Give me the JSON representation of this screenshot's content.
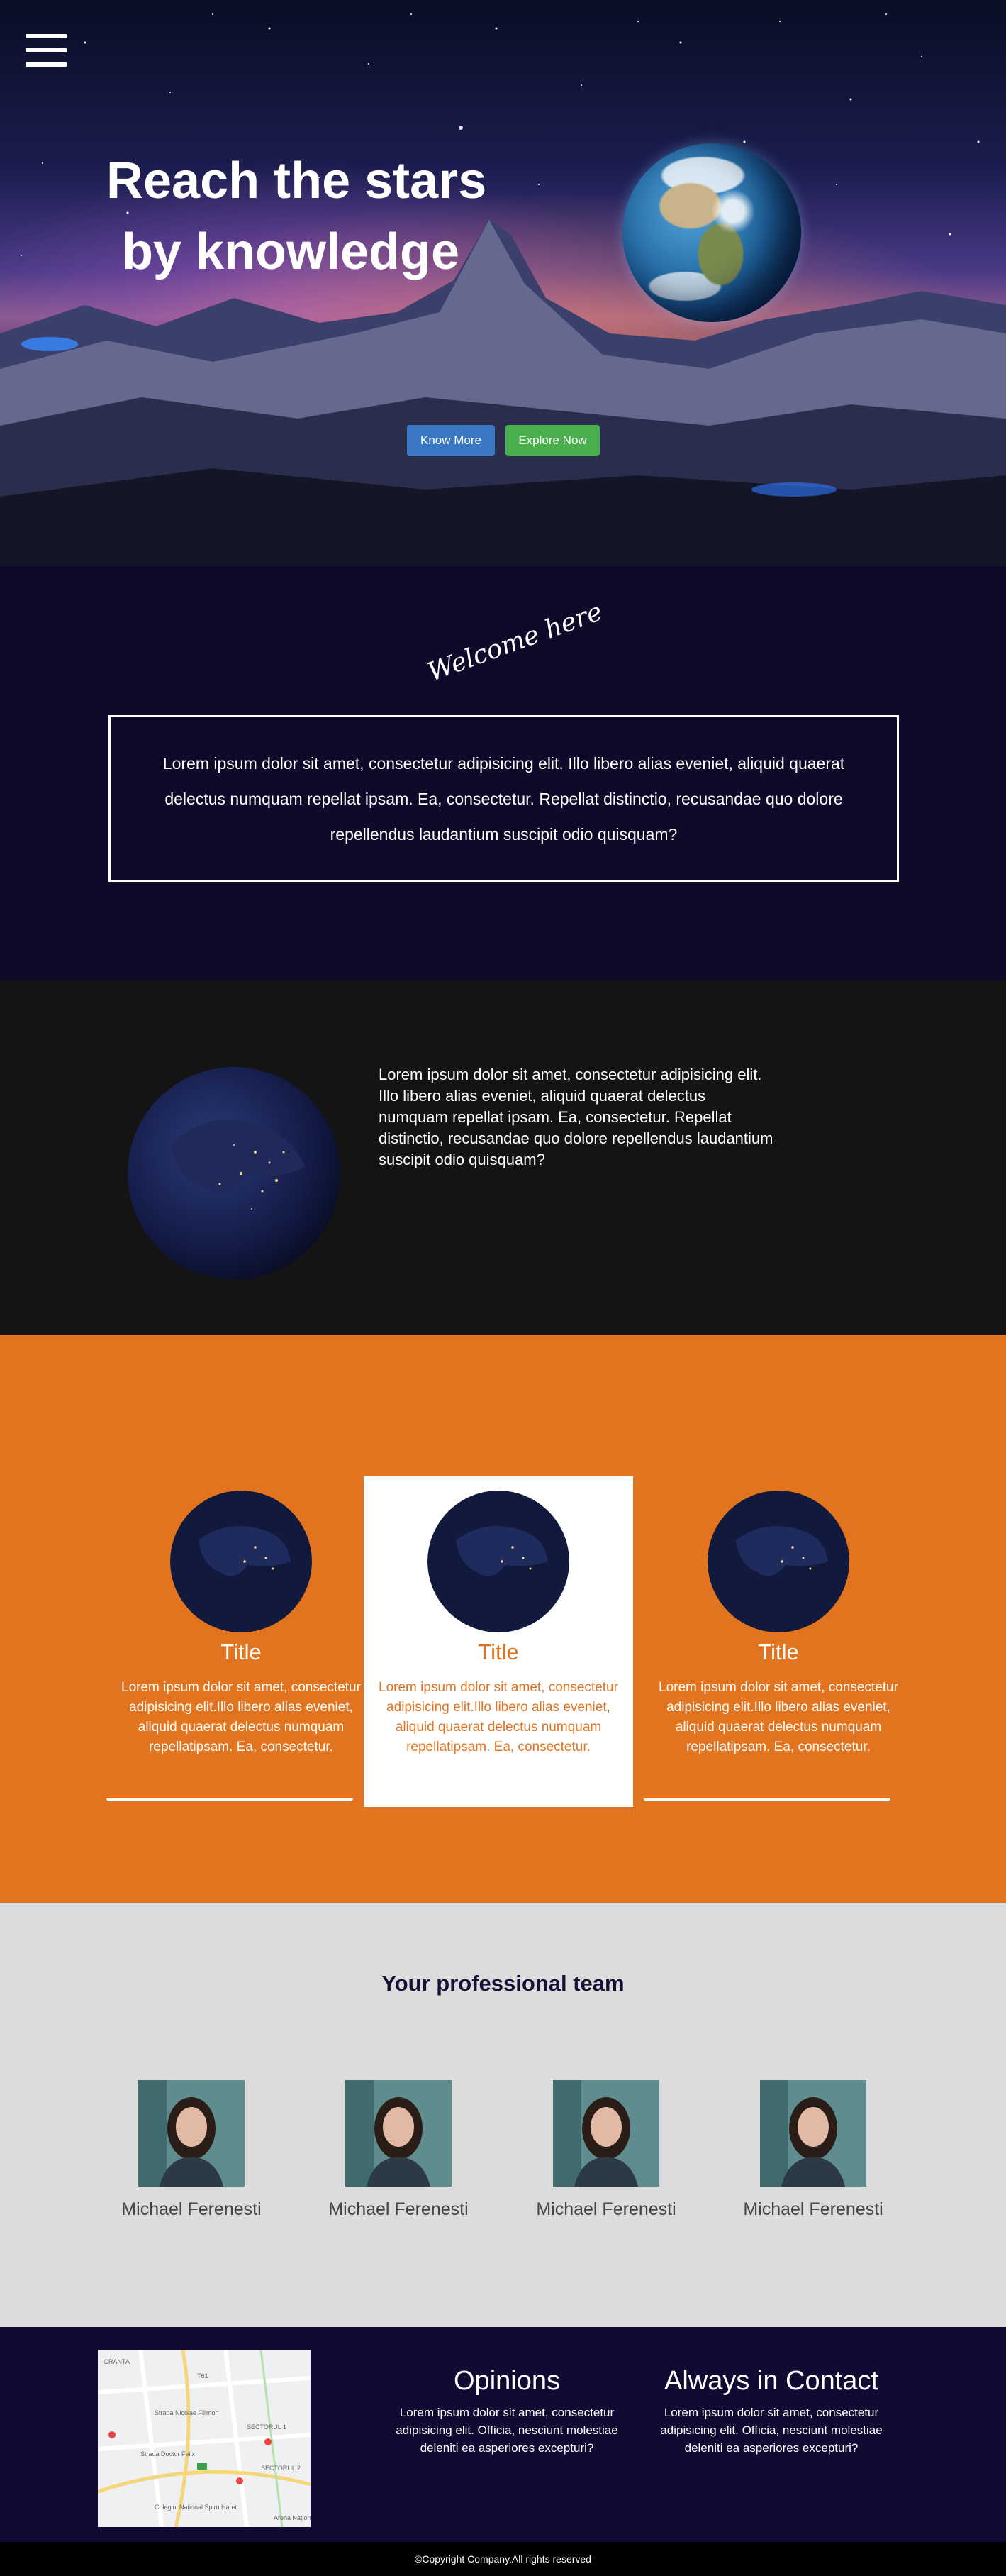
{
  "hero": {
    "title_line1": "Reach the stars",
    "title_line2": "by knowledge",
    "know_more_label": "Know More",
    "explore_now_label": "Explore Now"
  },
  "welcome": {
    "script_heading": "Welcome here",
    "text": "Lorem ipsum dolor sit amet, consectetur adipisicing elit. Illo libero alias eveniet, aliquid quaerat delectus numquam repellat ipsam. Ea, consectetur. Repellat distinctio, recusandae quo dolore repellendus laudantium suscipit odio quisquam?"
  },
  "night": {
    "text": "Lorem ipsum dolor sit amet, consectetur adipisicing elit. Illo libero alias eveniet, aliquid quaerat delectus numquam repellat ipsam. Ea, consectetur. Repellat distinctio, recusandae quo dolore repellendus laudantium suscipit odio quisquam?"
  },
  "cards": [
    {
      "title": "Title",
      "text": "Lorem ipsum dolor sit amet, consectetur adipisicing elit.Illo libero alias eveniet, aliquid quaerat delectus numquam repellatipsam. Ea, consectetur."
    },
    {
      "title": "Title",
      "text": "Lorem ipsum dolor sit amet, consectetur adipisicing elit.Illo libero alias eveniet, aliquid quaerat delectus numquam repellatipsam. Ea, consectetur."
    },
    {
      "title": "Title",
      "text": "Lorem ipsum dolor sit amet, consectetur adipisicing elit.Illo libero alias eveniet, aliquid quaerat delectus numquam repellatipsam. Ea, consectetur."
    }
  ],
  "team": {
    "title": "Your professional team",
    "members": [
      {
        "name": "Michael Ferenesti"
      },
      {
        "name": "Michael Ferenesti"
      },
      {
        "name": "Michael Ferenesti"
      },
      {
        "name": "Michael Ferenesti"
      }
    ]
  },
  "info": {
    "map_labels": [
      "GRANTA",
      "T61",
      "Strada Nicolae Filimon",
      "SECTORUL 1",
      "Strada Doctor Felix",
      "SECTORUL 2",
      "Colegiul Național Spiru Haret",
      "Arena Naționa"
    ],
    "opinions_title": "Opinions",
    "opinions_text": "Lorem ipsum dolor sit amet, consectetur adipisicing elit. Officia, nesciunt molestiae deleniti ea asperiores excepturi?",
    "contact_title": "Always in Contact",
    "contact_text": "Lorem ipsum dolor sit amet, consectetur adipisicing elit. Officia, nesciunt molestiae deleniti ea asperiores excepturi?"
  },
  "footer": {
    "copyright": "©Copyright Company.All rights reserved"
  },
  "colors": {
    "orange": "#e2731f",
    "navy": "#0f0a2a",
    "know_more": "#3a78c4",
    "explore_now": "#4ab04d",
    "team_bg": "#dcdcdc"
  }
}
